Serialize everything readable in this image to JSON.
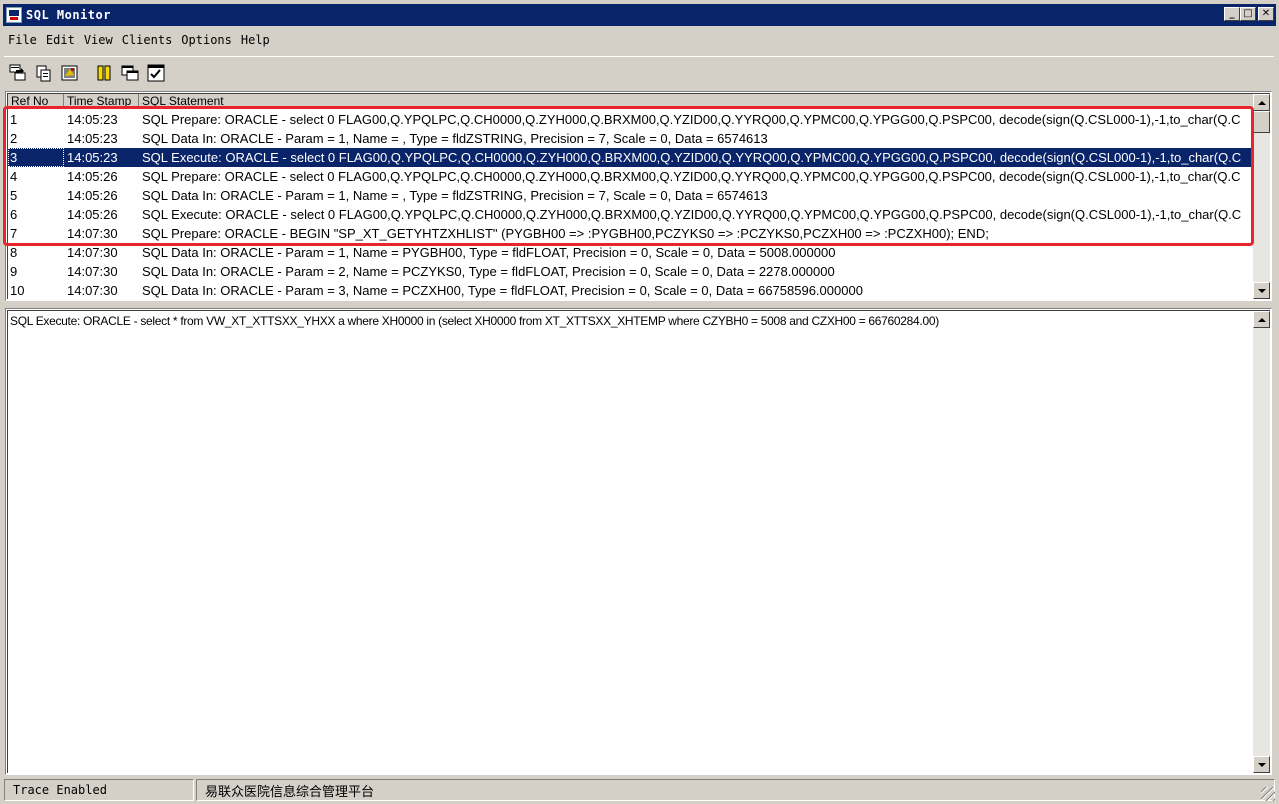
{
  "window": {
    "title": "SQL Monitor",
    "buttons": {
      "minimize": "_",
      "maximize": "□",
      "close": "✕"
    }
  },
  "menu": [
    "File",
    "Edit",
    "View",
    "Clients",
    "Options",
    "Help"
  ],
  "toolbar": [
    {
      "icon": "save-log-icon"
    },
    {
      "icon": "copy-icon"
    },
    {
      "icon": "print-icon"
    },
    {
      "icon": "pause-icon"
    },
    {
      "icon": "window-icon"
    },
    {
      "icon": "options-checklist-icon"
    }
  ],
  "grid": {
    "headers": {
      "ref": "Ref No",
      "time": "Time Stamp",
      "stmt": "SQL Statement"
    },
    "rows": [
      {
        "ref": "1",
        "time": "14:05:23",
        "stmt": "SQL Prepare: ORACLE - select 0 FLAG00,Q.YPQLPC,Q.CH0000,Q.ZYH000,Q.BRXM00,Q.YZID00,Q.YYRQ00,Q.YPMC00,Q.YPGG00,Q.PSPC00, decode(sign(Q.CSL000-1),-1,to_char(Q.C"
      },
      {
        "ref": "2",
        "time": "14:05:23",
        "stmt": "SQL Data In: ORACLE - Param = 1, Name = , Type = fldZSTRING, Precision = 7, Scale = 0, Data = 6574613"
      },
      {
        "ref": "3",
        "time": "14:05:23",
        "stmt": "SQL Execute: ORACLE - select 0 FLAG00,Q.YPQLPC,Q.CH0000,Q.ZYH000,Q.BRXM00,Q.YZID00,Q.YYRQ00,Q.YPMC00,Q.YPGG00,Q.PSPC00, decode(sign(Q.CSL000-1),-1,to_char(Q.C"
      },
      {
        "ref": "4",
        "time": "14:05:26",
        "stmt": "SQL Prepare: ORACLE - select 0 FLAG00,Q.YPQLPC,Q.CH0000,Q.ZYH000,Q.BRXM00,Q.YZID00,Q.YYRQ00,Q.YPMC00,Q.YPGG00,Q.PSPC00, decode(sign(Q.CSL000-1),-1,to_char(Q.C"
      },
      {
        "ref": "5",
        "time": "14:05:26",
        "stmt": "SQL Data In: ORACLE - Param = 1, Name = , Type = fldZSTRING, Precision = 7, Scale = 0, Data = 6574613"
      },
      {
        "ref": "6",
        "time": "14:05:26",
        "stmt": "SQL Execute: ORACLE - select 0 FLAG00,Q.YPQLPC,Q.CH0000,Q.ZYH000,Q.BRXM00,Q.YZID00,Q.YYRQ00,Q.YPMC00,Q.YPGG00,Q.PSPC00, decode(sign(Q.CSL000-1),-1,to_char(Q.C"
      },
      {
        "ref": "7",
        "time": "14:07:30",
        "stmt": "SQL Prepare: ORACLE - BEGIN \"SP_XT_GETYHTZXHLIST\" (PYGBH00 => :PYGBH00,PCZYKS0 => :PCZYKS0,PCZXH00 => :PCZXH00); END;"
      },
      {
        "ref": "8",
        "time": "14:07:30",
        "stmt": "SQL Data In: ORACLE - Param = 1, Name = PYGBH00, Type = fldFLOAT, Precision = 0, Scale = 0, Data = 5008.000000"
      },
      {
        "ref": "9",
        "time": "14:07:30",
        "stmt": "SQL Data In: ORACLE - Param = 2, Name = PCZYKS0, Type = fldFLOAT, Precision = 0, Scale = 0, Data = 2278.000000"
      },
      {
        "ref": "10",
        "time": "14:07:30",
        "stmt": "SQL Data In: ORACLE - Param = 3, Name = PCZXH00, Type = fldFLOAT, Precision = 0, Scale = 0, Data = 66758596.000000"
      }
    ],
    "selected_row": 3
  },
  "detail": {
    "text": "SQL Execute: ORACLE - select * from VW_XT_XTTSXX_YHXX a where XH0000 in (select XH0000 from XT_XTTSXX_XHTEMP where CZYBH0 = 5008 and CZXH00 = 66760284.00)"
  },
  "status": {
    "left": "Trace Enabled",
    "right": "易联众医院信息综合管理平台"
  },
  "colors": {
    "titlebar": "#0a246a",
    "selection": "#0a246a",
    "highlight": "#e8252d",
    "face": "#d4d0c8"
  }
}
